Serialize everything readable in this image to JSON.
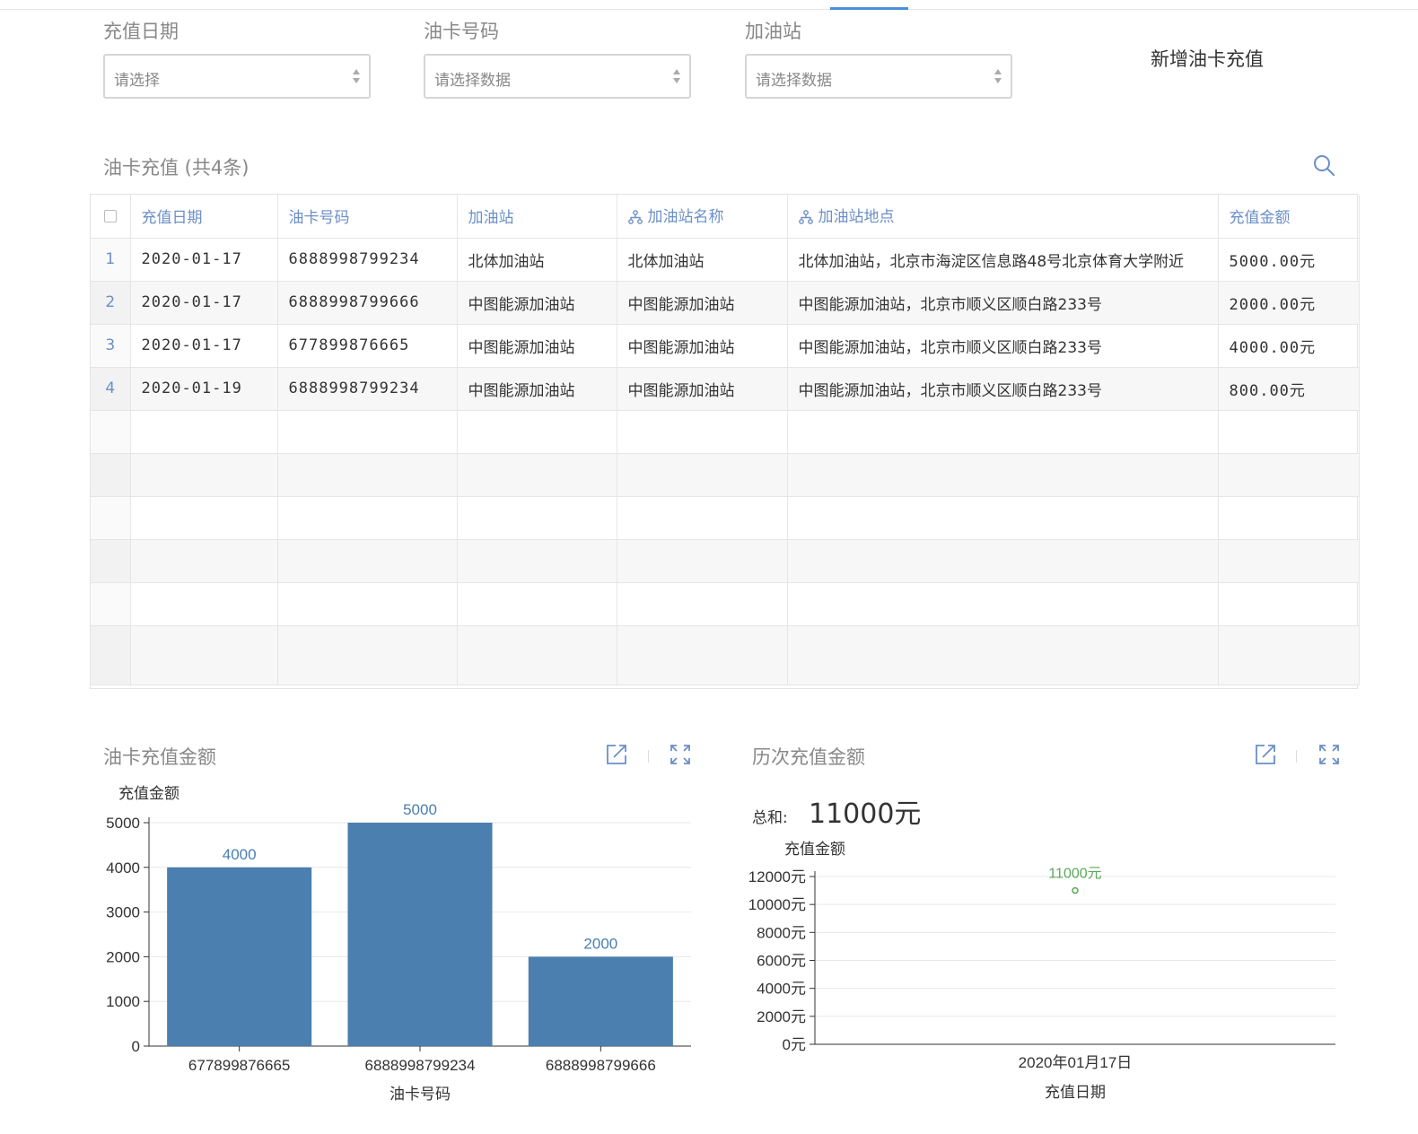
{
  "filters": [
    {
      "label": "充值日期",
      "placeholder": "请选择"
    },
    {
      "label": "油卡号码",
      "placeholder": "请选择数据"
    },
    {
      "label": "加油站",
      "placeholder": "请选择数据"
    }
  ],
  "add_button": "新增油卡充值",
  "table": {
    "title": "油卡充值 (共4条)",
    "columns": [
      "充值日期",
      "油卡号码",
      "加油站",
      "加油站名称",
      "加油站地点",
      "充值金额"
    ],
    "rows": [
      {
        "num": "1",
        "date": "2020-01-17",
        "card": "6888998799234",
        "station": "北体加油站",
        "station_name": "北体加油站",
        "location": "北体加油站，北京市海淀区信息路48号北京体育大学附近",
        "amount": "5000.00元"
      },
      {
        "num": "2",
        "date": "2020-01-17",
        "card": "6888998799666",
        "station": "中图能源加油站",
        "station_name": "中图能源加油站",
        "location": "中图能源加油站，北京市顺义区顺白路233号",
        "amount": "2000.00元"
      },
      {
        "num": "3",
        "date": "2020-01-17",
        "card": "677899876665",
        "station": "中图能源加油站",
        "station_name": "中图能源加油站",
        "location": "中图能源加油站，北京市顺义区顺白路233号",
        "amount": "4000.00元"
      },
      {
        "num": "4",
        "date": "2020-01-19",
        "card": "6888998799234",
        "station": "中图能源加油站",
        "station_name": "中图能源加油站",
        "location": "中图能源加油站，北京市顺义区顺白路233号",
        "amount": "800.00元"
      }
    ]
  },
  "panels": {
    "left_title": "油卡充值金额",
    "right_title": "历次充值金额",
    "sum_label": "总和:",
    "sum_value": "11000元"
  },
  "colors": {
    "bar": "#4a7fb0",
    "bar_label": "#4a7fb0",
    "point": "#5aa85a",
    "accent": "#4a90d9"
  },
  "chart_data": [
    {
      "type": "bar",
      "title": "油卡充值金额",
      "xlabel": "油卡号码",
      "ylabel": "充值金额",
      "categories": [
        "677899876665",
        "6888998799234",
        "6888998799666"
      ],
      "values": [
        4000,
        5000,
        2000
      ],
      "yticks": [
        0,
        1000,
        2000,
        3000,
        4000,
        5000
      ],
      "ylim": [
        0,
        5000
      ],
      "grid": true
    },
    {
      "type": "scatter",
      "title": "历次充值金额",
      "xlabel": "充值日期",
      "ylabel": "充值金额",
      "categories": [
        "2020年01月17日"
      ],
      "values": [
        11000
      ],
      "point_labels": [
        "11000元"
      ],
      "yticks": [
        "0元",
        "2000元",
        "4000元",
        "6000元",
        "8000元",
        "10000元",
        "12000元"
      ],
      "ylim": [
        0,
        12000
      ],
      "grid": true
    }
  ]
}
